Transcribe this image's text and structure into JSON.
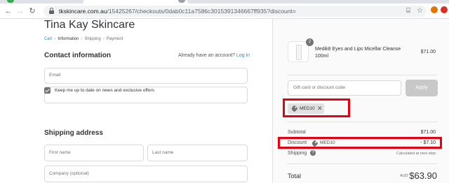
{
  "browser": {
    "back_icon": "arrow-left-icon",
    "forward_icon": "arrow-right-icon",
    "reload_icon": "reload-icon",
    "url_host": "tkskincare.com.au",
    "url_path": "/15425267/checkouts/0dab0c11a7586c3015391346667ff935?discount=",
    "translate_icon": "translate-icon",
    "star_icon": "star-icon"
  },
  "shop": {
    "title": "Tina Kay Skincare"
  },
  "breadcrumbs": {
    "cart": "Cart",
    "information": "Information",
    "shipping": "Shipping",
    "payment": "Payment",
    "separator": "›"
  },
  "contact": {
    "title": "Contact information",
    "have_account": "Already have an account?",
    "login": "Log in",
    "email_placeholder": "Email",
    "newsletter_label": "Keep me up to date on news and exclusive offers"
  },
  "shipping_address": {
    "title": "Shipping address",
    "first_name_placeholder": "First name",
    "last_name_placeholder": "Last name",
    "company_placeholder": "Company (optional)"
  },
  "order": {
    "item": {
      "quantity": "2",
      "name": "Medik8 Eyes and Lips Micellar Cleanse 100ml",
      "price": "$71.00"
    },
    "gift_placeholder": "Gift card or discount code",
    "apply_label": "Apply",
    "applied_code": "MED10",
    "remove_icon": "close-icon",
    "subtotal_label": "Subtotal",
    "subtotal_value": "$71.00",
    "discount_label": "Discount",
    "discount_code": "MED10",
    "discount_value": "- $7.10",
    "shipping_label": "Shipping",
    "shipping_value": "Calculated at next step",
    "total_label": "Total",
    "currency": "AUD",
    "total_value": "$63.90"
  },
  "colors": {
    "highlight": "#e60012",
    "link": "#1990c6"
  }
}
